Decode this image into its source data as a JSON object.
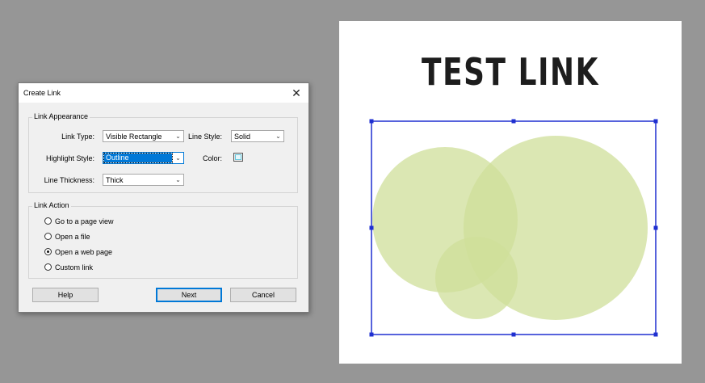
{
  "dialog": {
    "title": "Create Link",
    "close_glyph": "✕",
    "appearance": {
      "legend": "Link Appearance",
      "link_type_label": "Link Type:",
      "link_type_value": "Visible Rectangle",
      "line_style_label": "Line Style:",
      "line_style_value": "Solid",
      "highlight_style_label": "Highlight Style:",
      "highlight_style_value": "Outline",
      "color_label": "Color:",
      "line_thickness_label": "Line Thickness:",
      "line_thickness_value": "Thick"
    },
    "action": {
      "legend": "Link Action",
      "options": [
        {
          "label": "Go to a page view",
          "checked": false
        },
        {
          "label": "Open a file",
          "checked": false
        },
        {
          "label": "Open a web page",
          "checked": true
        },
        {
          "label": "Custom link",
          "checked": false
        }
      ]
    },
    "buttons": {
      "help": "Help",
      "next": "Next",
      "cancel": "Cancel"
    },
    "dropdown_glyph": "⌄"
  },
  "document": {
    "title": "TEST LINK",
    "link_rect_color": "#1f2fd0",
    "circle_color": "#cfdf9a"
  }
}
